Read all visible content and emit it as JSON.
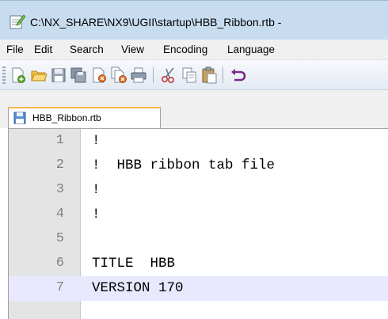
{
  "window": {
    "title": "C:\\NX_SHARE\\NX9\\UGII\\startup\\HBB_Ribbon.rtb -"
  },
  "menubar": {
    "items": [
      "File",
      "Edit",
      "Search",
      "View",
      "Encoding",
      "Language"
    ]
  },
  "toolbar": {
    "buttons": [
      "new-file-icon",
      "open-file-icon",
      "save-icon",
      "save-all-icon",
      "close-icon",
      "close-all-icon",
      "print-icon",
      "cut-icon",
      "copy-icon",
      "paste-icon",
      "undo-icon"
    ]
  },
  "tabs": [
    {
      "label": "HBB_Ribbon.rtb"
    }
  ],
  "editor": {
    "current_line": 7,
    "lines": [
      {
        "num": "1",
        "text": "!"
      },
      {
        "num": "2",
        "text": "!  HBB ribbon tab file"
      },
      {
        "num": "3",
        "text": "!"
      },
      {
        "num": "4",
        "text": "!"
      },
      {
        "num": "5",
        "text": ""
      },
      {
        "num": "6",
        "text": "TITLE  HBB"
      },
      {
        "num": "7",
        "text": "VERSION 170"
      }
    ]
  },
  "colors": {
    "titlebar": "#c8dcf0",
    "current_line_highlight": "#e8e8ff",
    "gutter": "#e4e4e4",
    "tab_accent": "#f6b84a"
  }
}
